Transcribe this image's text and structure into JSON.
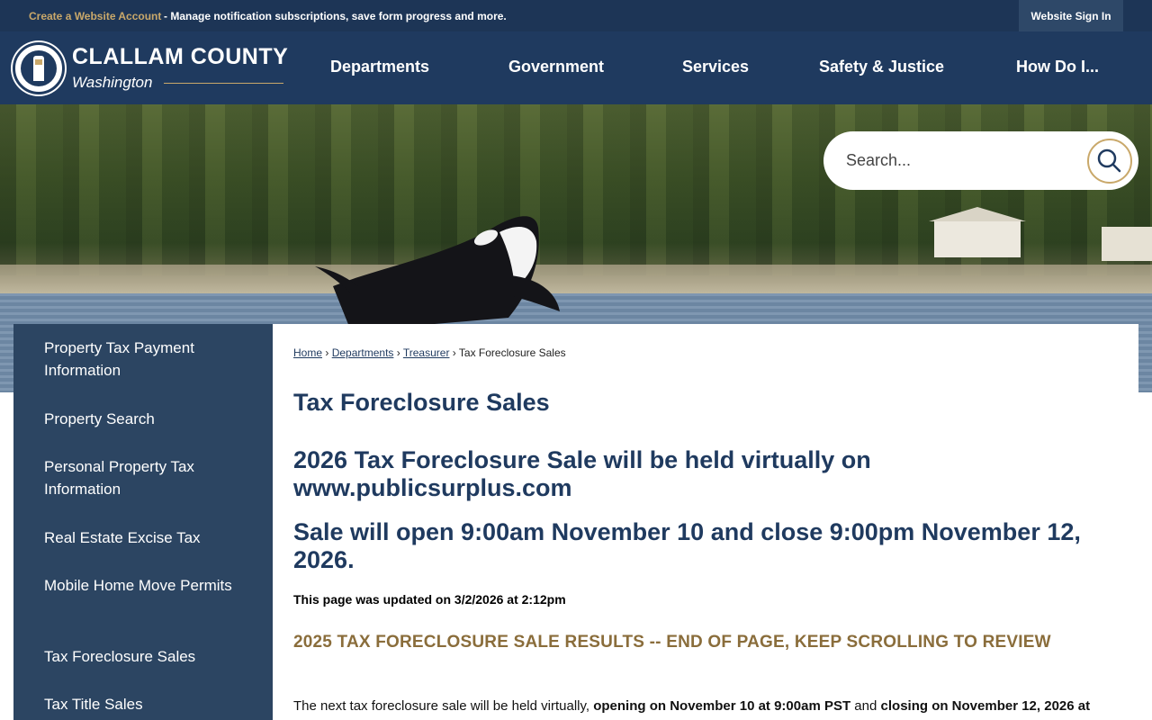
{
  "topbar": {
    "create_account": "Create a Website Account",
    "notice": "- Manage notification subscriptions, save form progress and more.",
    "signin": "Website Sign In"
  },
  "header": {
    "title": "CLALLAM COUNTY",
    "subtitle": "Washington",
    "nav": [
      "Departments",
      "Government",
      "Services",
      "Safety & Justice",
      "How Do I..."
    ]
  },
  "search": {
    "placeholder": "Search..."
  },
  "sidebar": {
    "items": [
      "Property Tax Payment Information",
      "Property Search",
      "Personal Property Tax Information",
      "Real Estate Excise Tax",
      "Mobile Home Move Permits",
      "Tax Foreclosure Sales",
      "Tax Title Sales"
    ]
  },
  "breadcrumb": {
    "home": "Home",
    "sep": "›",
    "departments": "Departments",
    "treasurer": "Treasurer",
    "current": "Tax Foreclosure Sales"
  },
  "main": {
    "title": "Tax Foreclosure Sales",
    "heading1": "2026 Tax Foreclosure Sale will be held virtually on www.publicsurplus.com",
    "heading2": "Sale will open 9:00am November 10 and close 9:00pm November 12, 2026.",
    "updated": "This page was updated on 3/2/2026 at 2:12pm",
    "results": "2025 TAX FORECLOSURE SALE RESULTS -- END OF PAGE, KEEP SCROLLING TO REVIEW",
    "para_a": "The next tax foreclosure sale will be held virtually, ",
    "para_b": "opening on November 10 at 9:00am PST",
    "para_c": " and ",
    "para_d": "closing on November 12, 2026 at"
  },
  "colors": {
    "navy": "#1f3a5f",
    "gold": "#c9a86a",
    "sidebar": "#2c4562"
  }
}
